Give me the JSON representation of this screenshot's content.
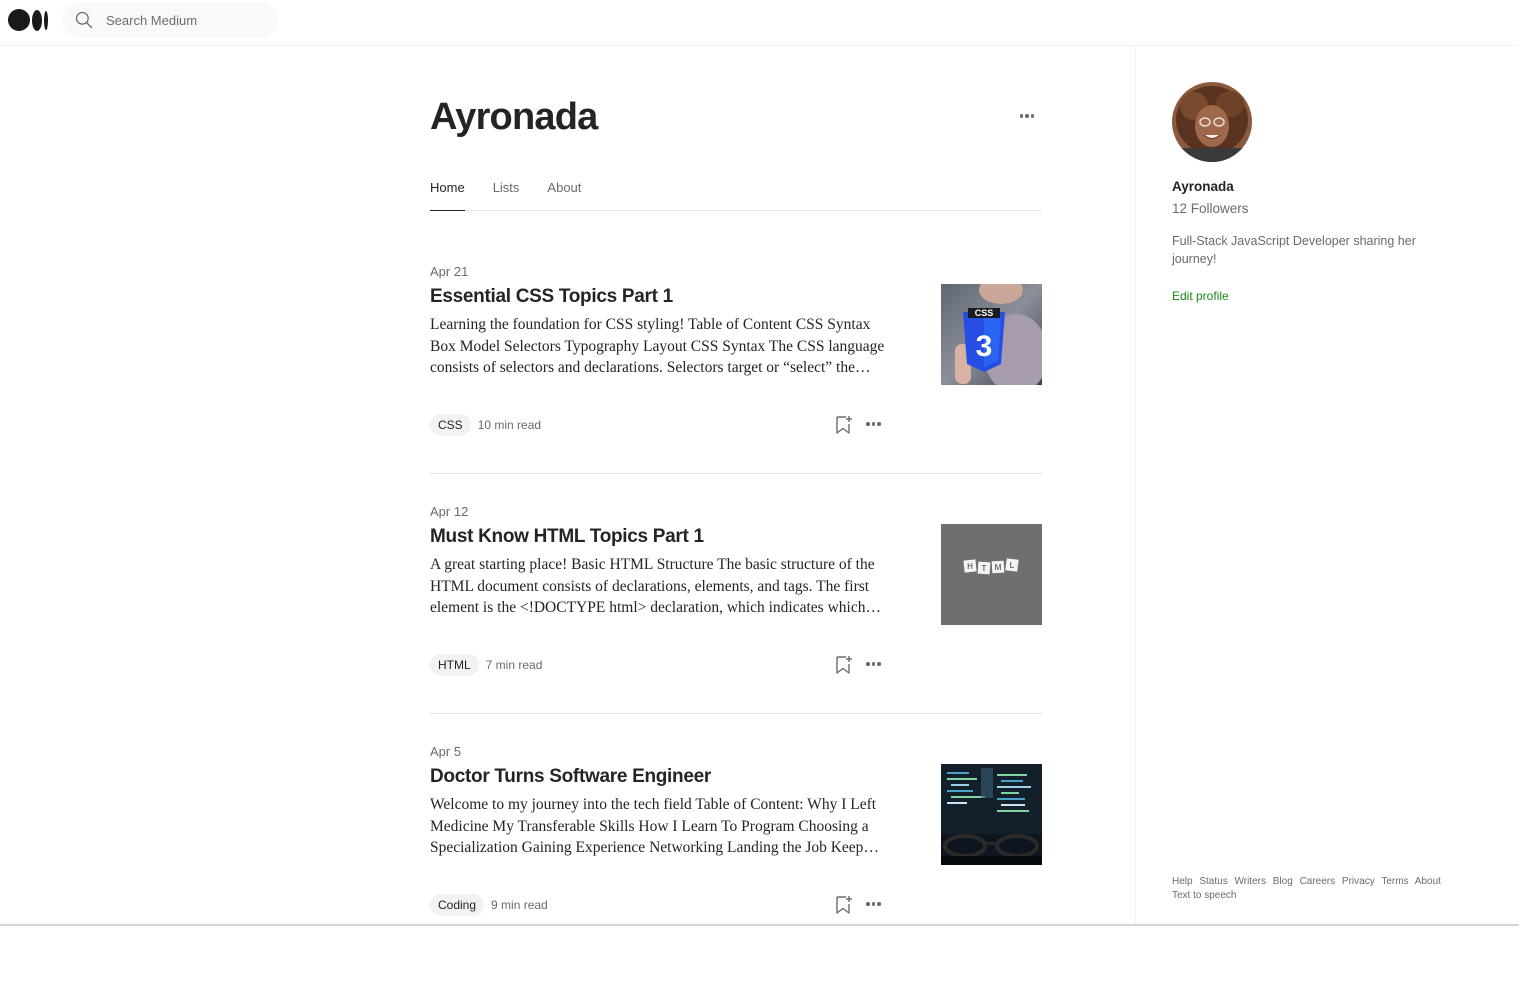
{
  "search": {
    "placeholder": "Search Medium"
  },
  "profile": {
    "name": "Ayronada",
    "tabs": [
      {
        "label": "Home",
        "active": true
      },
      {
        "label": "Lists",
        "active": false
      },
      {
        "label": "About",
        "active": false
      }
    ]
  },
  "articles": [
    {
      "date": "Apr 21",
      "title": "Essential CSS Topics Part 1",
      "excerpt": "Learning the foundation for CSS styling! Table of Content CSS Syntax Box Model Selectors Typography Layout CSS Syntax The CSS language consists of selectors and declarations. Selectors target or “select” the elements you want to style.",
      "tag": "CSS",
      "read_time": "10 min read",
      "thumb_text": "CSS"
    },
    {
      "date": "Apr 12",
      "title": "Must Know HTML Topics Part 1",
      "excerpt": "A great starting place! Basic HTML Structure The basic structure of the HTML document consists of declarations, elements, and tags. The first element is the <!DOCTYPE html> declaration, which indicates which version of HTML is used.",
      "tag": "HTML",
      "read_time": "7 min read",
      "thumb_letters": [
        "H",
        "T",
        "M",
        "L"
      ]
    },
    {
      "date": "Apr 5",
      "title": "Doctor Turns Software Engineer",
      "excerpt": "Welcome to my journey into the tech field Table of Content: Why I Left Medicine My Transferable Skills How I Learn To Program Choosing a Specialization Gaining Experience Networking Landing the Job Keep going and never give up.",
      "tag": "Coding",
      "read_time": "9 min read"
    }
  ],
  "sidebar": {
    "name": "Ayronada",
    "followers": "12 Followers",
    "bio": "Full-Stack JavaScript Developer sharing her journey!",
    "edit_label": "Edit profile"
  },
  "footer": {
    "links": [
      "Help",
      "Status",
      "Writers",
      "Blog",
      "Careers",
      "Privacy",
      "Terms",
      "About",
      "Text to speech"
    ]
  },
  "colors": {
    "accent_green": "#1a8917",
    "text_primary": "#242424",
    "text_secondary": "#6b6b6b"
  }
}
